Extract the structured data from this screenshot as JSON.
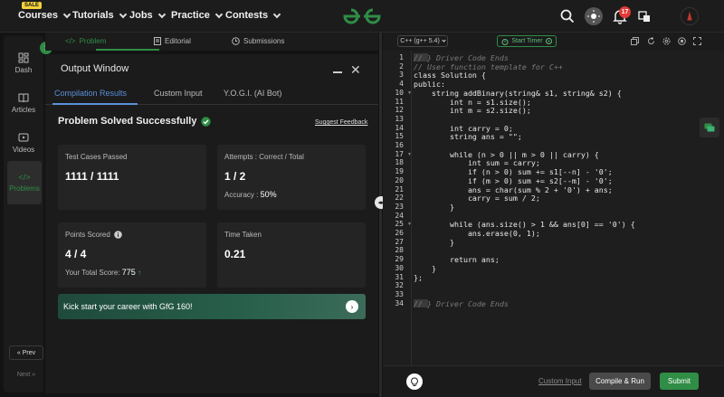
{
  "nav": {
    "sale_badge": "SALE",
    "items": [
      "Courses",
      "Tutorials",
      "Jobs",
      "Practice",
      "Contests"
    ],
    "notification_count": "17"
  },
  "rail": {
    "items": [
      "Dash",
      "Articles",
      "Videos",
      "Problems"
    ],
    "prev_label": "« Prev",
    "next_label": "Next »"
  },
  "problem_tabs": [
    "Problem",
    "Editorial",
    "Submissions"
  ],
  "output": {
    "title": "Output Window",
    "tabs": [
      "Compilation Results",
      "Custom Input",
      "Y.O.G.I. (AI Bot)"
    ],
    "status": "Problem Solved Successfully",
    "feedback_link": "Suggest Feedback",
    "cards": {
      "test_cases": {
        "label": "Test Cases Passed",
        "value": "1111 / 1111"
      },
      "attempts": {
        "label": "Attempts : Correct / Total",
        "value": "1 / 2",
        "sub_label": "Accuracy :",
        "sub_value": "50%"
      },
      "points": {
        "label": "Points Scored",
        "value": "4 / 4",
        "sub_label": "Your Total Score:",
        "sub_value": "775"
      },
      "time": {
        "label": "Time Taken",
        "value": "0.21"
      }
    },
    "banner": "Kick start your career with GfG 160!"
  },
  "editor": {
    "language": "C++ (g++ 5.4)",
    "timer_label": "Start Timer",
    "lines": [
      {
        "n": "1",
        "text": "// } Driver Code Ends",
        "comment": true,
        "hl": true
      },
      {
        "n": "2",
        "text": "// User function template for C++",
        "comment": true
      },
      {
        "n": "3",
        "text": "class Solution {"
      },
      {
        "n": "4",
        "text": "public:"
      },
      {
        "n": "10",
        "text": "    string addBinary(string& s1, string& s2) {"
      },
      {
        "n": "11",
        "text": "        int n = s1.size();"
      },
      {
        "n": "12",
        "text": "        int m = s2.size();"
      },
      {
        "n": "13",
        "text": ""
      },
      {
        "n": "14",
        "text": "        int carry = 0;"
      },
      {
        "n": "15",
        "text": "        string ans = \"\";"
      },
      {
        "n": "16",
        "text": ""
      },
      {
        "n": "17",
        "text": "        while (n > 0 || m > 0 || carry) {"
      },
      {
        "n": "18",
        "text": "            int sum = carry;"
      },
      {
        "n": "19",
        "text": "            if (n > 0) sum += s1[--n] - '0';"
      },
      {
        "n": "20",
        "text": "            if (m > 0) sum += s2[--m] - '0';"
      },
      {
        "n": "21",
        "text": "            ans = char(sum % 2 + '0') + ans;"
      },
      {
        "n": "22",
        "text": "            carry = sum / 2;"
      },
      {
        "n": "23",
        "text": "        }"
      },
      {
        "n": "24",
        "text": ""
      },
      {
        "n": "25",
        "text": "        while (ans.size() > 1 && ans[0] == '0') {"
      },
      {
        "n": "26",
        "text": "            ans.erase(0, 1);"
      },
      {
        "n": "27",
        "text": "        }"
      },
      {
        "n": "28",
        "text": ""
      },
      {
        "n": "29",
        "text": "        return ans;"
      },
      {
        "n": "30",
        "text": "    }"
      },
      {
        "n": "31",
        "text": "};"
      },
      {
        "n": "32",
        "text": ""
      },
      {
        "n": "33",
        "text": ""
      },
      {
        "n": "34",
        "text": "// } Driver Code Ends",
        "comment": true,
        "hl": true
      }
    ],
    "custom_input_link": "Custom Input",
    "compile_label": "Compile & Run",
    "submit_label": "Submit"
  },
  "colors": {
    "brand_green": "#2f8d46",
    "accent_blue": "#5b8fd9",
    "notification_red": "#e53935"
  }
}
